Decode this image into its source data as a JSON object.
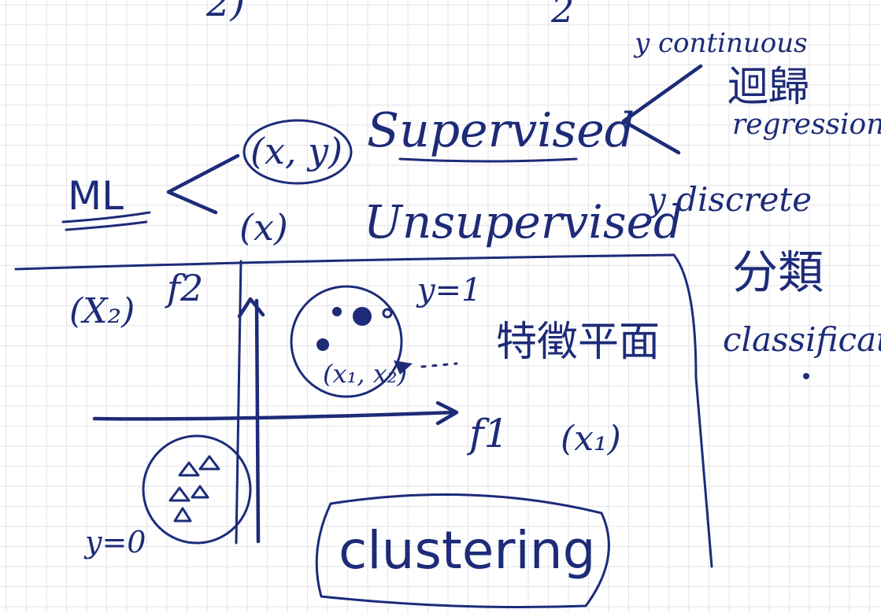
{
  "labels": {
    "ml": "ML",
    "xy": "(x, y)",
    "x": "(x)",
    "supervised": "Supervised",
    "unsupervised": "Unsupervised",
    "y_continuous": "y continuous",
    "regression_zh": "迴歸",
    "regression": "regression",
    "y_discrete": "y discrete",
    "classification_zh": "分類",
    "classification": "classification",
    "x2": "(X₂)",
    "f2": "f2",
    "y1": "y=1",
    "feature_plane_zh": "特徵平面",
    "x1x2": "(x₁, x₂)",
    "f1": "f1",
    "x1": "(x₁)",
    "y0": "y=0",
    "clustering": "clustering",
    "top_left_mark": "2)",
    "top_mid_mark": "2"
  },
  "colors": {
    "ink": "#1d2b78",
    "grid": "#e3e3e8",
    "paper": "#ffffff"
  }
}
